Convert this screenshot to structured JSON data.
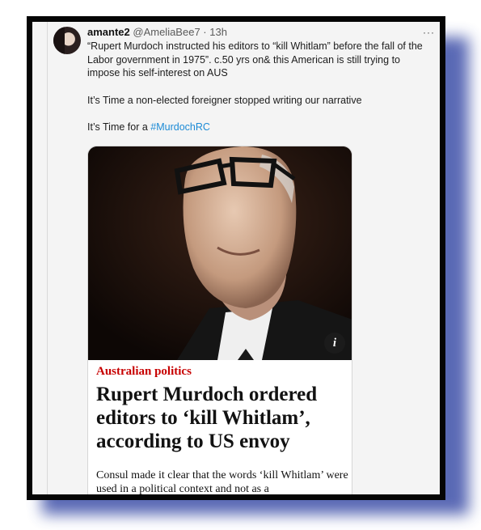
{
  "tweet": {
    "display_name": "amante2",
    "handle": "@AmeliaBee7",
    "separator": "·",
    "time": "13h",
    "more_label": "···",
    "lines": [
      "“Rupert Murdoch instructed his editors to “kill Whitlam” before the fall of the Labor government in 1975”. c.50 yrs on& this American is still trying to impose his self-interest on AUS",
      "It’s Time a non-elected foreigner stopped writing our narrative"
    ],
    "last_line_prefix": "It’s Time for a ",
    "hashtag": "#MurdochRC"
  },
  "card": {
    "image_icon": "info-icon",
    "info_label": "i",
    "kicker": "Australian politics",
    "headline": "Rupert Murdoch ordered editors to ‘kill Whitlam’, according to US envoy",
    "standfirst": "Consul made it clear that the words ‘kill Whitlam’ were used in a political context and not as a"
  },
  "colors": {
    "hashtag": "#1d8bd6",
    "kicker": "#c70000",
    "frame": "#050505",
    "shadow": "#3d4fa8"
  }
}
